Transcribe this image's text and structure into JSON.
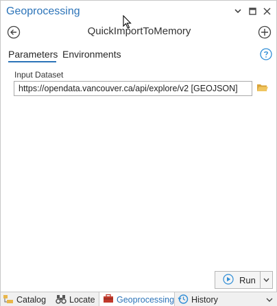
{
  "pane": {
    "title": "Geoprocessing",
    "tool_title": "QuickImportToMemory"
  },
  "tabs": {
    "parameters": "Parameters",
    "environments": "Environments"
  },
  "input_dataset": {
    "label": "Input Dataset",
    "value": "https://opendata.vancouver.ca/api/explore/v2 [GEOJSON]"
  },
  "run": {
    "label": "Run"
  },
  "bottom_tabs": {
    "catalog": "Catalog",
    "locate": "Locate",
    "geoprocessing": "Geoprocessing",
    "history": "History"
  },
  "colors": {
    "accent": "#2b73b8",
    "folder": "#e8b64a",
    "run_green": "#2f8dd6"
  }
}
